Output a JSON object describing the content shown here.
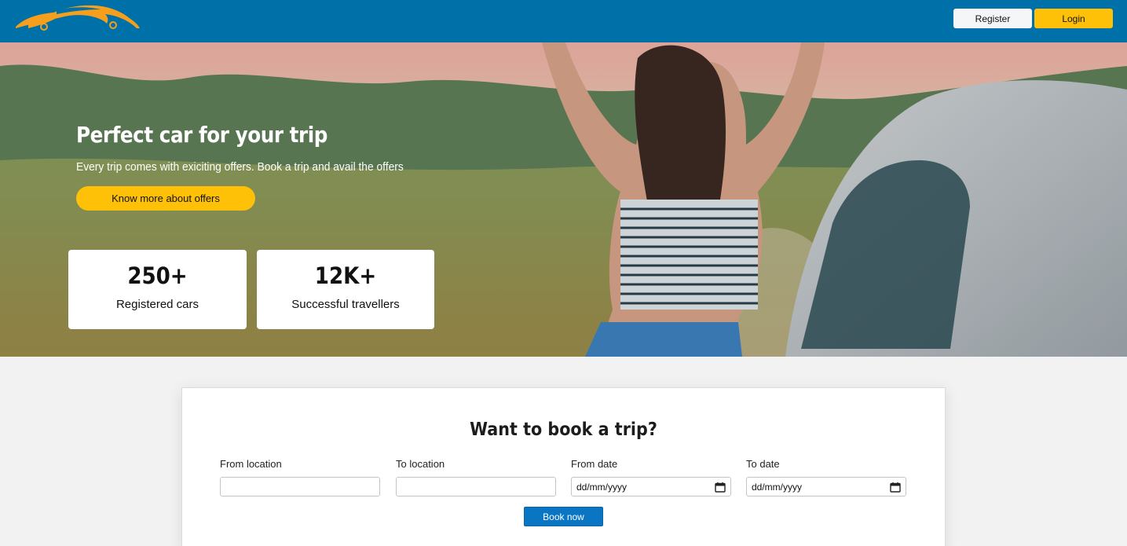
{
  "header": {
    "logo": "car-logo-icon",
    "register_label": "Register",
    "login_label": "Login",
    "colors": {
      "bar": "#0070a8",
      "login": "#ffc107",
      "register": "#f4f6f8"
    }
  },
  "hero": {
    "title": "Perfect car for your trip",
    "subtitle": "Every trip comes with exiciting offers. Book a trip and avail the offers",
    "offers_button": "Know more about offers",
    "stats": [
      {
        "value": "250+",
        "label": "Registered cars"
      },
      {
        "value": "12K+",
        "label": "Successful travellers"
      }
    ]
  },
  "booking": {
    "title": "Want to book a trip?",
    "fields": [
      {
        "label": "From location",
        "value": ""
      },
      {
        "label": "To location",
        "value": ""
      },
      {
        "label": "From date",
        "value": "dd/mm/yyyy",
        "icon": "calendar-icon"
      },
      {
        "label": "To date",
        "value": "dd/mm/yyyy",
        "icon": "calendar-icon"
      }
    ],
    "submit_label": "Book now",
    "colors": {
      "submit": "#0a75c2"
    }
  }
}
